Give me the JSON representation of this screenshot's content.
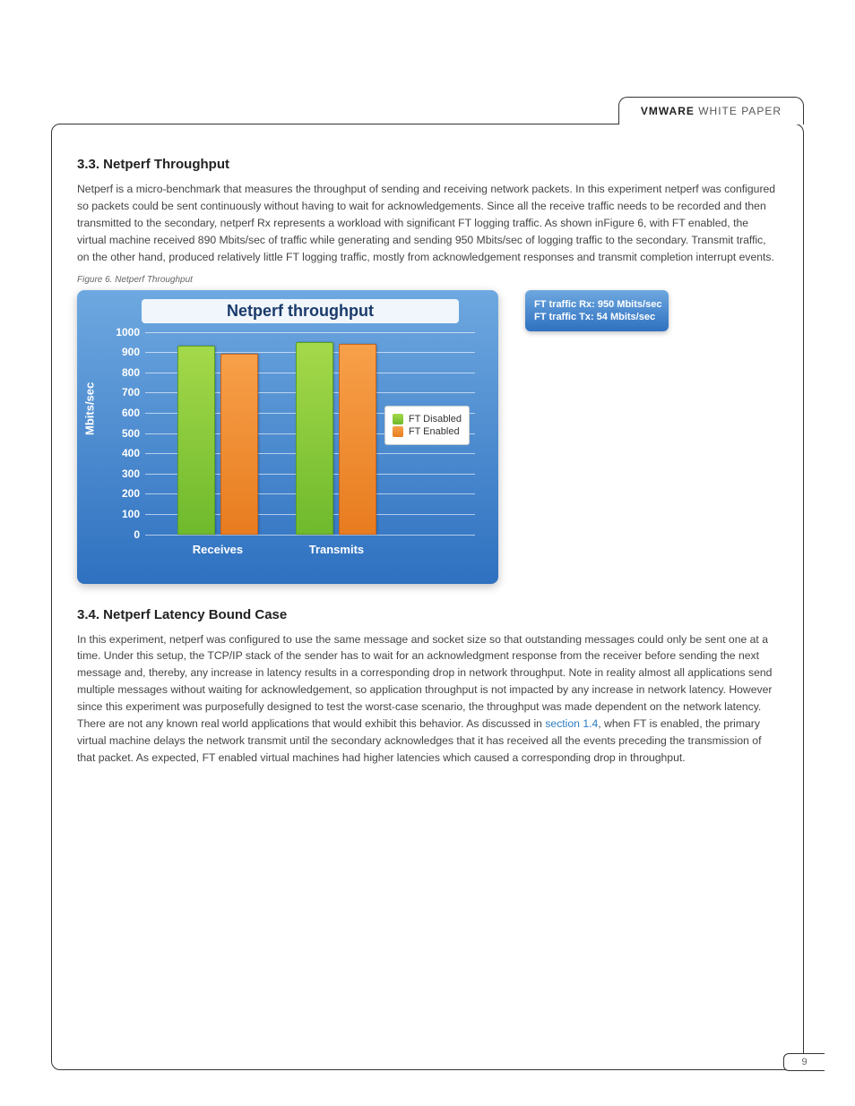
{
  "header": {
    "brand": "VMWARE",
    "label": "WHITE PAPER"
  },
  "page_number": "9",
  "section1": {
    "heading": "3.3. Netperf Throughput",
    "paragraph": "Netperf is a micro-benchmark that measures the throughput of sending and receiving network packets. In this experiment netperf was configured so packets could be sent continuously without having to wait for acknowledgements. Since all the receive traffic needs to be recorded and then transmitted to the secondary, netperf Rx represents a workload with significant FT logging traffic. As shown inFigure 6, with FT enabled, the virtual machine received 890 Mbits/sec of traffic while generating and sending 950 Mbits/sec of logging traffic to the secondary. Transmit traffic, on the other hand, produced relatively little FT logging traffic, mostly from acknowledgement responses and transmit completion interrupt events."
  },
  "figure_caption": "Figure 6. Netperf Throughput",
  "sidebox": {
    "line1": "FT traffic Rx: 950 Mbits/sec",
    "line2": "FT traffic Tx: 54 Mbits/sec"
  },
  "chart_data": {
    "type": "bar",
    "title": "Netperf throughput",
    "ylabel": "Mbits/sec",
    "ylim": [
      0,
      1000
    ],
    "yticks": [
      0,
      100,
      200,
      300,
      400,
      500,
      600,
      700,
      800,
      900,
      1000
    ],
    "categories": [
      "Receives",
      "Transmits"
    ],
    "series": [
      {
        "name": "FT Disabled",
        "color": "green",
        "values": [
          930,
          950
        ]
      },
      {
        "name": "FT Enabled",
        "color": "orange",
        "values": [
          890,
          940
        ]
      }
    ],
    "legend_position": "right"
  },
  "section2": {
    "heading": "3.4. Netperf Latency Bound Case",
    "paragraph_pre": "In this experiment, netperf was configured to use the same message and socket size so that outstanding messages could only be sent one at a time. Under this setup, the TCP/IP stack of the sender has to wait for an acknowledgment response from the receiver before sending the next message and, thereby, any increase in latency results in a corresponding drop in network throughput. Note in reality almost all applications send multiple messages without waiting for acknowledgement, so application throughput is not impacted by any increase in network latency. However since this experiment was purposefully designed to test the worst-case scenario, the throughput was made dependent on the network latency. There are not any known real world applications that would exhibit this behavior. As discussed in ",
    "paragraph_link": "section 1.4",
    "paragraph_post": ", when FT is enabled, the primary virtual machine delays the network transmit until the secondary acknowledges that it has received all the events preceding the transmission of that packet. As expected, FT enabled virtual machines had higher latencies which caused a corresponding drop in throughput."
  }
}
